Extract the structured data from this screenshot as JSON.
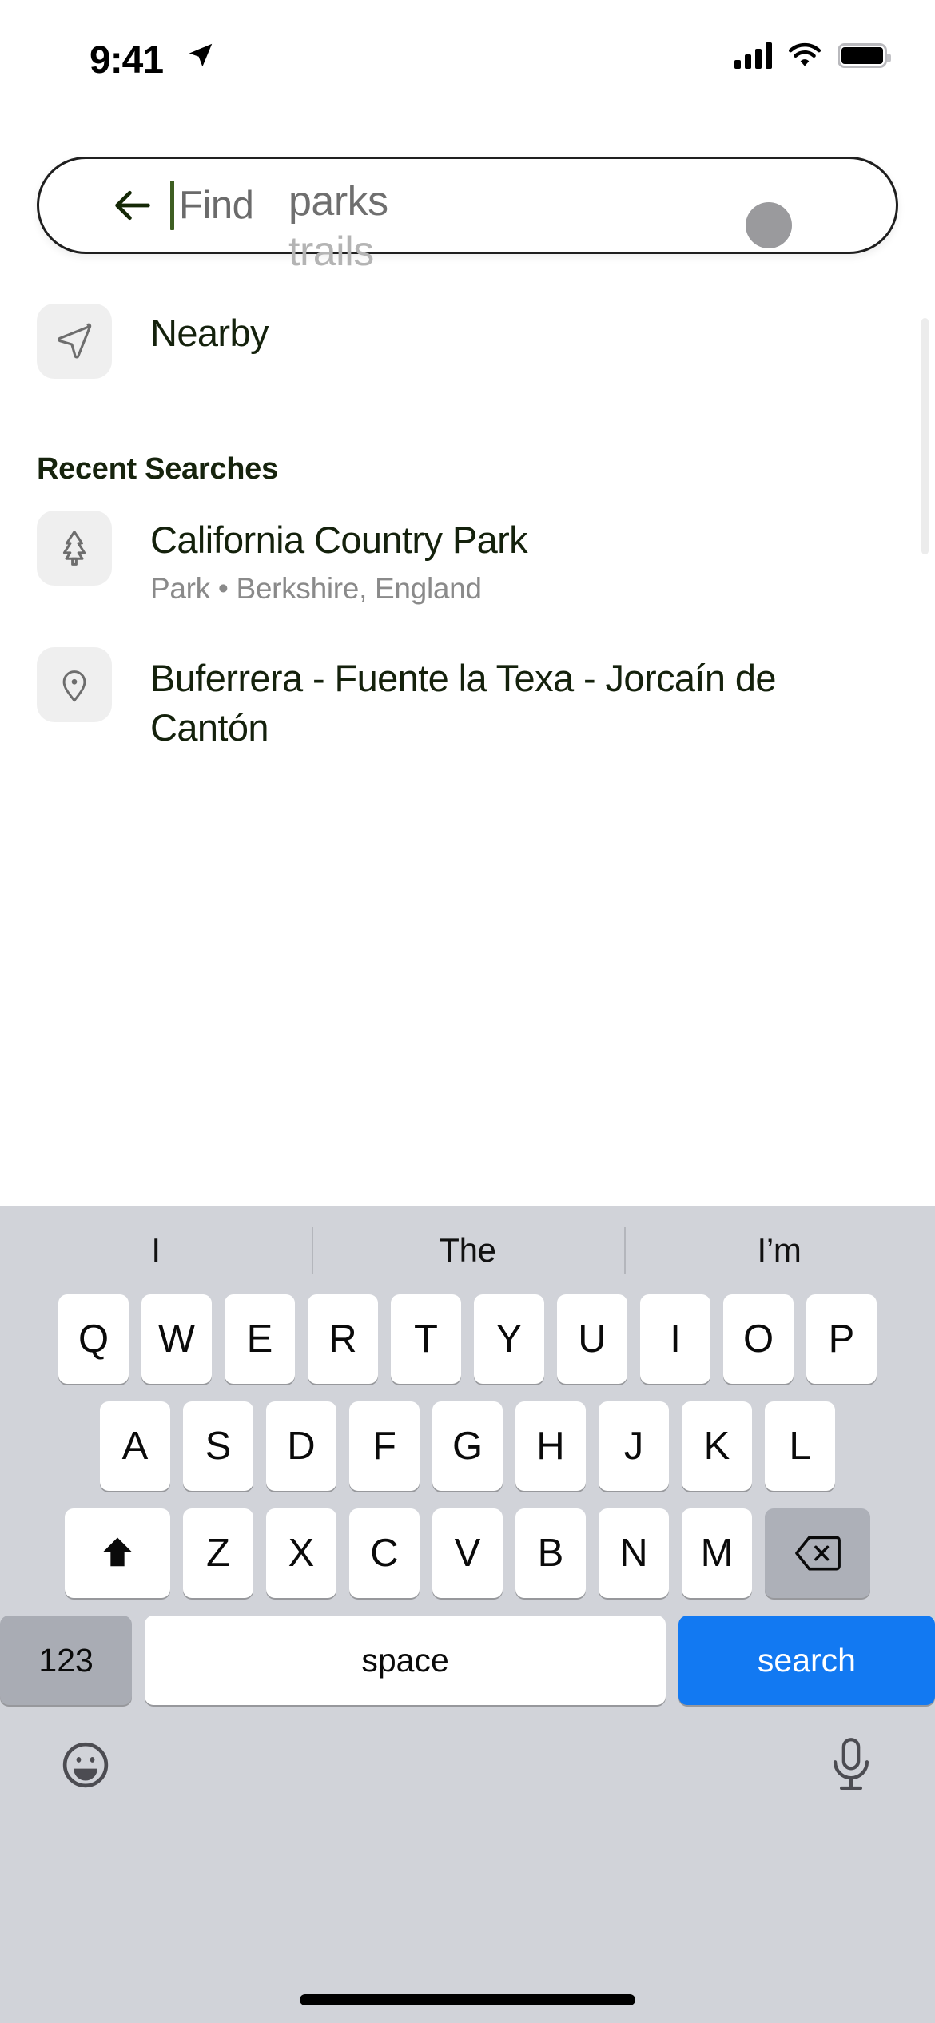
{
  "status": {
    "time": "9:41",
    "location_icon": "location-arrow-icon",
    "signal_icon": "cellular-signal-icon",
    "wifi_icon": "wifi-icon",
    "battery_icon": "battery-icon"
  },
  "search": {
    "back_icon": "back-arrow-icon",
    "typed_text": "Find",
    "placeholder_rotating_top": "parks",
    "placeholder_rotating_bottom": "trails",
    "avatar_name": "user-avatar"
  },
  "nearby": {
    "label": "Nearby",
    "icon": "navigation-arrow-icon"
  },
  "recent": {
    "heading": "Recent Searches",
    "items": [
      {
        "title": "California Country Park",
        "subtitle": "Park • Berkshire, England",
        "icon": "tree-icon"
      },
      {
        "title": "Buferrera - Fuente la Texa - Jorcaín de Cantón",
        "subtitle": "",
        "icon": "map-pin-icon"
      }
    ]
  },
  "keyboard": {
    "suggestions": [
      "I",
      "The",
      "I’m"
    ],
    "row1": [
      "Q",
      "W",
      "E",
      "R",
      "T",
      "Y",
      "U",
      "I",
      "O",
      "P"
    ],
    "row2": [
      "A",
      "S",
      "D",
      "F",
      "G",
      "H",
      "J",
      "K",
      "L"
    ],
    "row3": [
      "Z",
      "X",
      "C",
      "V",
      "B",
      "N",
      "M"
    ],
    "shift_icon": "shift-icon",
    "backspace_icon": "backspace-icon",
    "numbers_label": "123",
    "space_label": "space",
    "return_label": "search",
    "emoji_icon": "emoji-icon",
    "mic_icon": "microphone-icon"
  },
  "colors": {
    "accent_blue": "#1279f2",
    "caret_green": "#3e5f22",
    "keyboard_bg": "#d1d3d9",
    "thumb_bg": "#efefef"
  }
}
